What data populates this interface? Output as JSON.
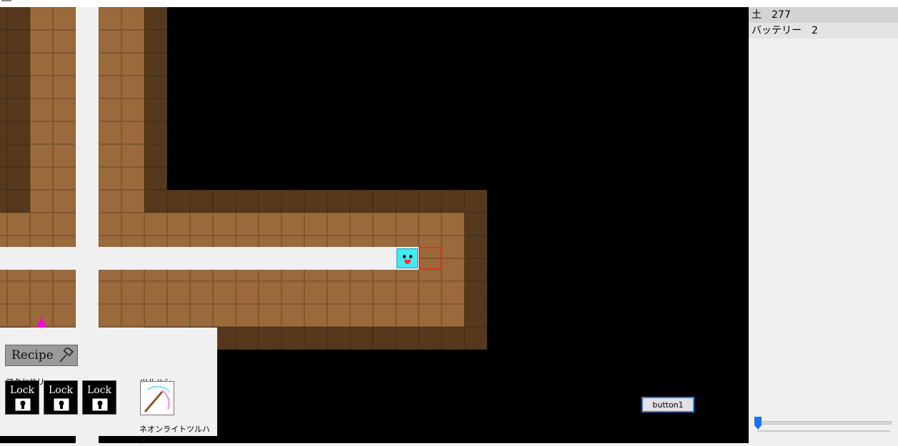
{
  "resources": [
    {
      "name": "土",
      "count": "277"
    },
    {
      "name": "バッテリー",
      "count": "2"
    }
  ],
  "hud": {
    "recipe_label": "Recipe",
    "accessory_label": "アクセサリー",
    "lock_label": "Lock",
    "pickaxe_label": "ツルハシ",
    "pickaxe_name": "ネオンライトツルハシ"
  },
  "controls": {
    "button1_label": "button1",
    "slider_value": 0
  },
  "colors": {
    "dirt": "#9a6a3c",
    "rock": "#56391d",
    "player": "#43e9f0",
    "cursor": "#e2331e",
    "flame": "#ff00e6"
  },
  "icons": {
    "recipe": "hammer-icon",
    "lock": "keyhole-icon",
    "pickaxe": "pickaxe-icon",
    "flame": "flame-icon"
  }
}
